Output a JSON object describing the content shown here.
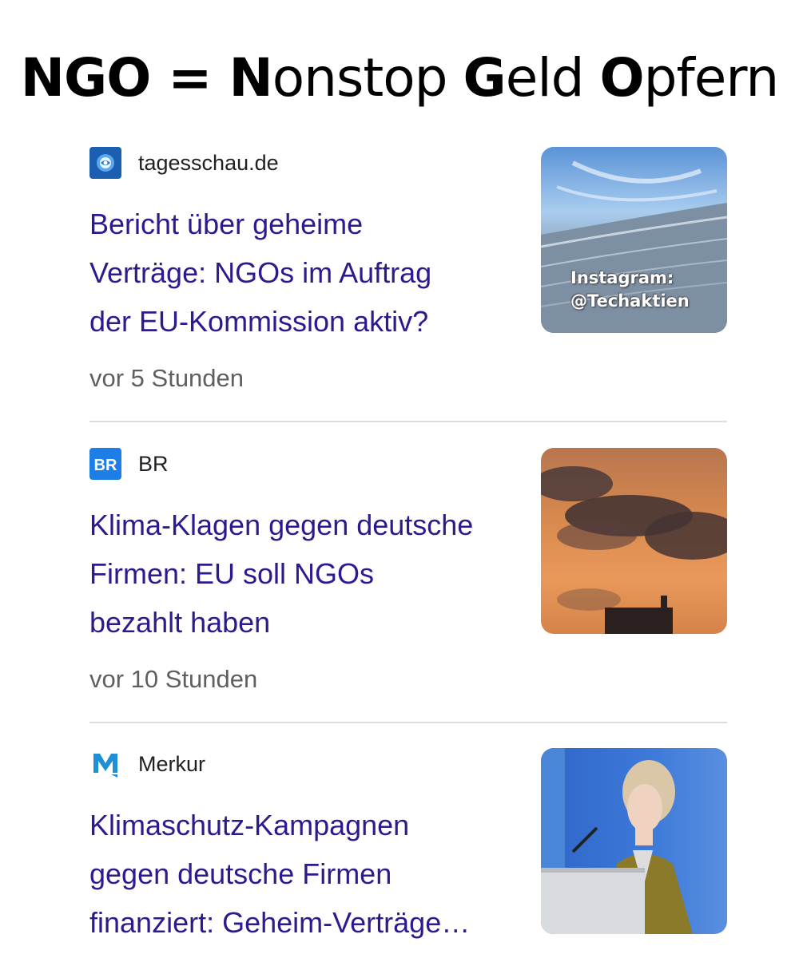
{
  "title": {
    "parts": [
      {
        "text": "NGO = N",
        "bold": true
      },
      {
        "text": "onstop ",
        "bold": false
      },
      {
        "text": "G",
        "bold": true
      },
      {
        "text": "eld ",
        "bold": false
      },
      {
        "text": "O",
        "bold": true
      },
      {
        "text": "pfern",
        "bold": false
      }
    ]
  },
  "articles": [
    {
      "source": "tagesschau.de",
      "favicon": "tagesschau-logo-icon",
      "headline_lines": [
        "Bericht über geheime",
        "Verträge: NGOs im Auftrag",
        "der EU-Kommission aktiv?"
      ],
      "time": "vor 5 Stunden",
      "thumbnail": "eu-commission-building-image",
      "watermark": [
        "Instagram:",
        "@Techaktien"
      ]
    },
    {
      "source": "BR",
      "favicon": "br-logo-icon",
      "headline_lines": [
        "Klima-Klagen gegen deutsche",
        "Firmen: EU soll NGOs",
        "bezahlt haben"
      ],
      "time": "vor 10 Stunden",
      "thumbnail": "smokestack-sunset-image"
    },
    {
      "source": "Merkur",
      "favicon": "merkur-logo-icon",
      "headline_lines": [
        "Klimaschutz-Kampagnen",
        "gegen deutsche Firmen",
        "finanziert: Geheim-Verträge…"
      ],
      "thumbnail": "speaker-at-podium-image"
    }
  ],
  "colors": {
    "headline": "#2c1a8f",
    "time": "#5f5f5f",
    "divider": "#dcdcdc",
    "tagesschau_blue": "#1c5fb0",
    "br_blue": "#1d7ee8",
    "merkur_blue": "#1f8fd6"
  }
}
